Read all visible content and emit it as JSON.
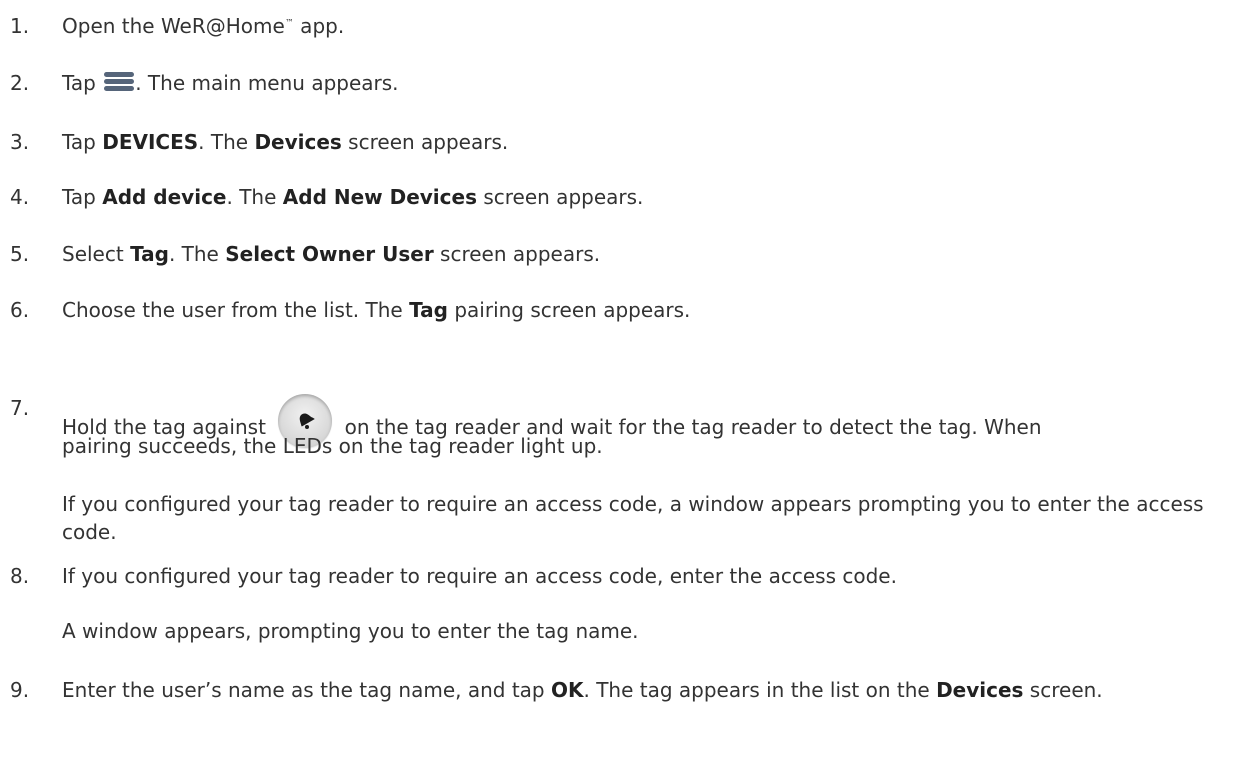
{
  "steps": [
    {
      "num": "1.",
      "pre": "Open the WeR@Home",
      "tm": "™",
      "post": " app."
    },
    {
      "num": "2.",
      "pre": "Tap ",
      "icon": "menu-icon",
      "post": ". The main menu appears."
    },
    {
      "num": "3.",
      "pre": "Tap ",
      "b1": "DEVICES",
      "mid": ". The ",
      "b2": "Devices",
      "post": " screen appears."
    },
    {
      "num": "4.",
      "pre": "Tap ",
      "b1": "Add device",
      "mid": ". The ",
      "b2": "Add New Devices",
      "post": " screen appears."
    },
    {
      "num": "5.",
      "pre": "Select ",
      "b1": "Tag",
      "mid": ". The ",
      "b2": "Select Owner User",
      "post": " screen appears."
    },
    {
      "num": "6.",
      "pre": "Choose the user from the list. The ",
      "b1": "Tag",
      "post": " pairing screen appears."
    },
    {
      "num": "7.",
      "pre": "Hold the tag against ",
      "icon": "bell-button-icon",
      "line1": " on the tag reader and wait for the tag reader to detect the tag. When",
      "line2": "pairing succeeds, the LEDs on the tag reader light up.",
      "para": "If you configured your tag reader to require an access code, a window appears prompting you to enter the access code."
    },
    {
      "num": "8.",
      "text": "If you configured your tag reader to require an access code, enter the access code.",
      "para": "A window appears, prompting you to enter the tag name."
    },
    {
      "num": "9.",
      "pre": "Enter the user’s name as the tag name, and tap ",
      "b1": "OK",
      "mid": ". The tag appears in the list on the ",
      "b2": "Devices",
      "post": " screen."
    }
  ],
  "colors": {
    "text": "#333333",
    "menu_icon": "#56657a",
    "button_gray": "#dcdcdc"
  }
}
